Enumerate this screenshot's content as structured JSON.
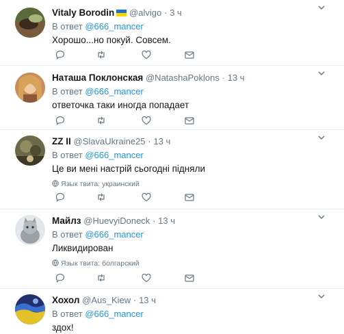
{
  "colors": {
    "link": "#1b95e0",
    "muted": "#657786",
    "text": "#14171a",
    "border": "#e6ecf0"
  },
  "tweets": [
    {
      "name": "Vitaly Borodin",
      "flag": "ukraine-flag-emoji",
      "handle": "@alvigo",
      "sep": "·",
      "time": "3 ч",
      "reply_prefix": "В ответ",
      "reply_to": "@666_mancer",
      "text": "Хорошо...но покуй. Совсем.",
      "lang": ""
    },
    {
      "name": "Наташа Поклонская",
      "handle": "@NatashaPoklons",
      "sep": "·",
      "time": "13 ч",
      "reply_prefix": "В ответ",
      "reply_to": "@666_mancer",
      "text": "ответочка таки иногда попадает",
      "lang": ""
    },
    {
      "name": "ZZ II",
      "handle": "@SlavaUkraine25",
      "sep": "·",
      "time": "13 ч",
      "reply_prefix": "В ответ",
      "reply_to": "@666_mancer",
      "text": "Це ви мені настрій сьогодні підняли",
      "lang": "Язык твита: украинский"
    },
    {
      "name": "Майлз",
      "handle": "@HuevyiDoneck",
      "sep": "·",
      "time": "13 ч",
      "reply_prefix": "В ответ",
      "reply_to": "@666_mancer",
      "text": "Ликвидирован",
      "lang": "Язык твита: болгарский"
    },
    {
      "name": "Хохол",
      "handle": "@Aus_Kiew",
      "sep": "·",
      "time": "13 ч",
      "reply_prefix": "В ответ",
      "reply_to": "@666_mancer",
      "text": "здох!",
      "lang": ""
    }
  ],
  "icons": {
    "reply": "reply-icon",
    "retweet": "retweet-icon",
    "like": "like-icon",
    "dm": "direct-message-icon",
    "caret": "chevron-down-icon",
    "globe": "globe-icon"
  }
}
